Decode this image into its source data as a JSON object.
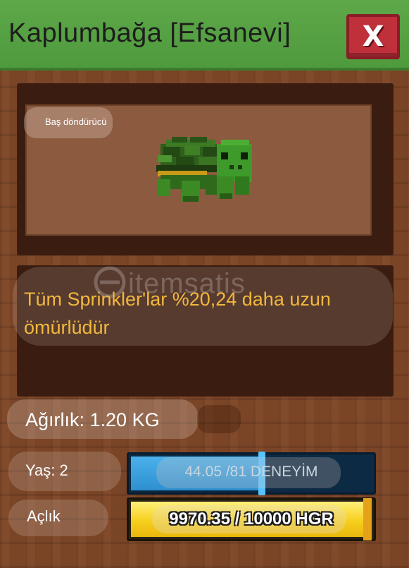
{
  "window": {
    "title": "Kaplumbağa [Efsanevi]",
    "close_icon": "close-x-icon",
    "colors": {
      "header": "#5ea84a",
      "close_button": "#c0303a",
      "panel": "#7a4426"
    }
  },
  "preview": {
    "mutation_label": "Baş döndürücü",
    "pet_icon": "green-turtle-icon"
  },
  "description": {
    "line1": "Tüm Sprinkler'lar %20,24 daha uzun",
    "line2": "ömürlüdür",
    "color": "#f2b83e"
  },
  "watermark": {
    "text": "itemsatis",
    "icon": "itemsatis-logo-icon"
  },
  "stats": {
    "weight": "Ağırlık: 1.20 KG",
    "age": "Yaş: 2",
    "xp": {
      "current": 44.05,
      "max": 81,
      "label": "44.05 /81 DENEYİM",
      "fill_color": "#4bb1ec"
    },
    "hunger": {
      "label": "Açlık",
      "current": 9970.35,
      "max": 10000,
      "value_text": "9970.35 / 10000 HGR",
      "fill_color": "#f6cf1d"
    }
  }
}
